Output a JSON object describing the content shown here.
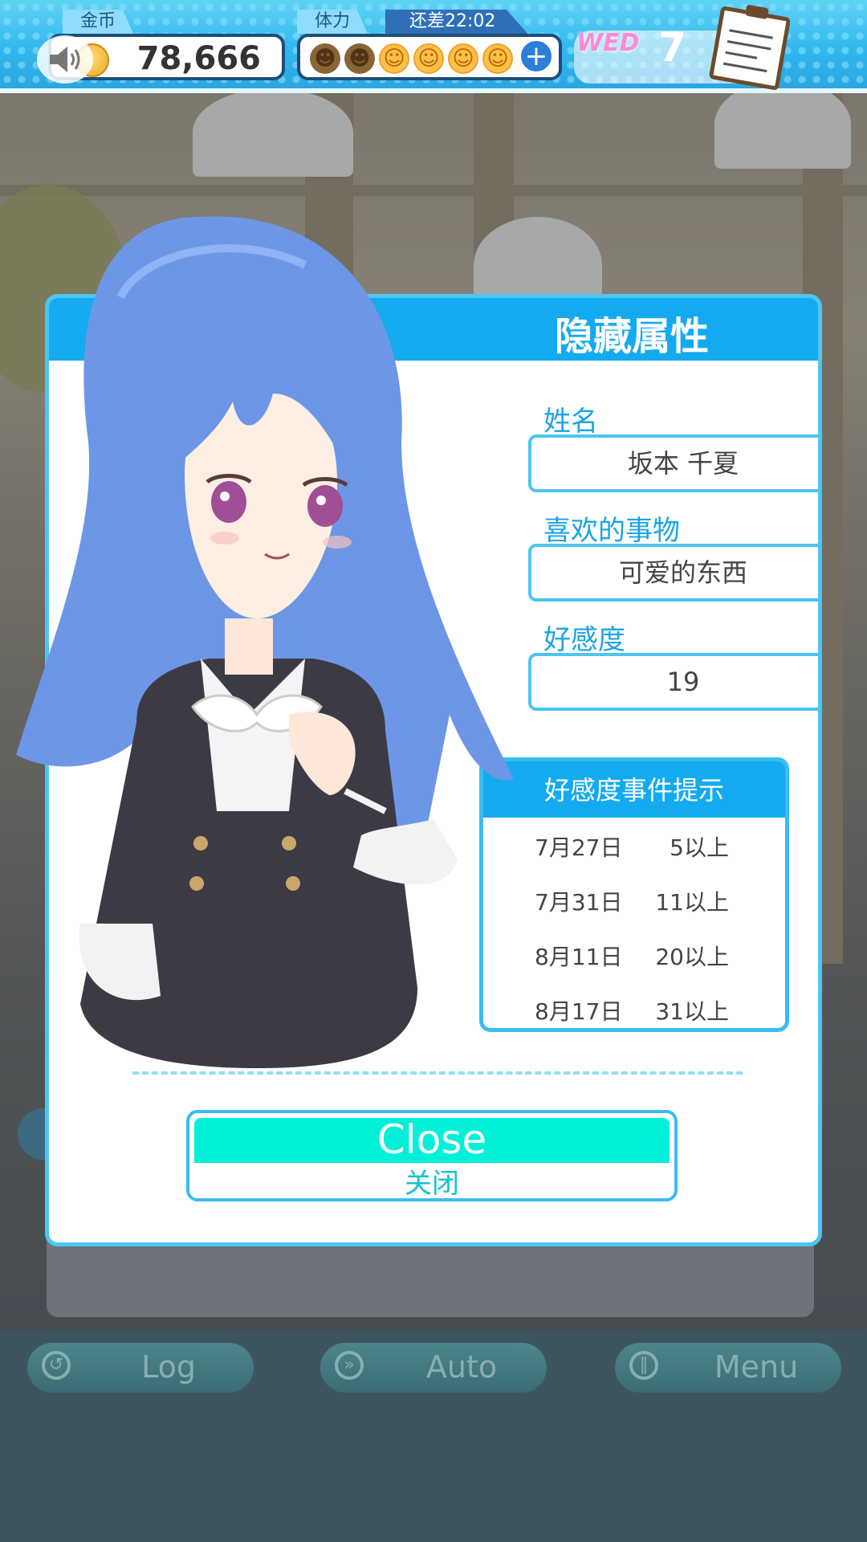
{
  "topbar": {
    "coin_label": "金币",
    "coin_value": "78,666",
    "stamina_label": "体力",
    "stamina_timer": "还差22:02",
    "stamina_faces": [
      "used",
      "used",
      "full",
      "full",
      "full",
      "full"
    ],
    "weekday": "WED",
    "day": "7"
  },
  "dialog": {
    "title": "隐藏属性",
    "name_label": "姓名",
    "name_value": "坂本 千夏",
    "likes_label": "喜欢的事物",
    "likes_value": "可爱的东西",
    "affinity_label": "好感度",
    "affinity_value": "19",
    "events_title": "好感度事件提示",
    "events": [
      {
        "date": "7月27日",
        "req": "5以上"
      },
      {
        "date": "7月31日",
        "req": "11以上"
      },
      {
        "date": "8月11日",
        "req": "20以上"
      },
      {
        "date": "8月17日",
        "req": "31以上"
      }
    ],
    "close_en": "Close",
    "close_zh": "关闭"
  },
  "bottom": {
    "log": "Log",
    "auto": "Auto",
    "menu": "Menu"
  },
  "colors": {
    "accent": "#14aaf0",
    "close_button": "#00f0d8",
    "border": "#4cc6f0"
  }
}
